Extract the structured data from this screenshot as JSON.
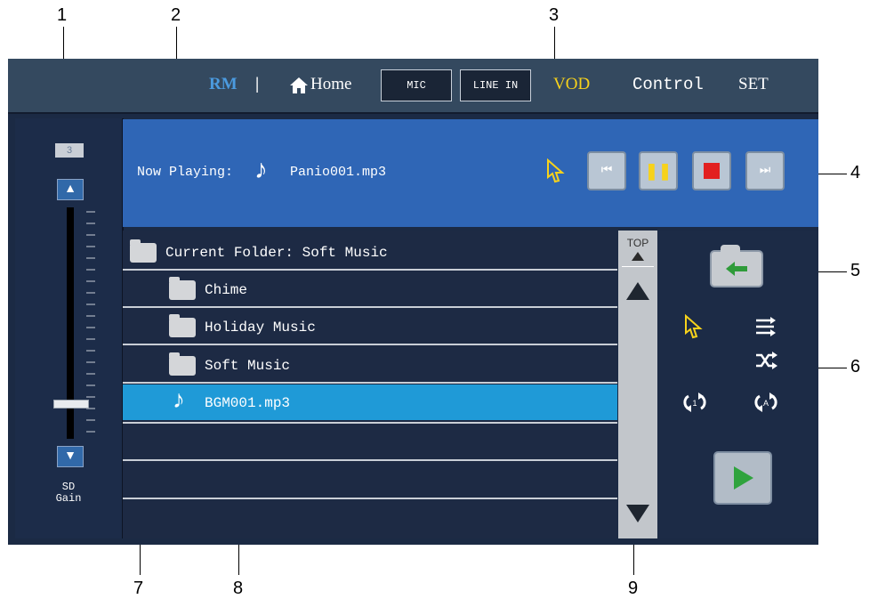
{
  "callouts": [
    "1",
    "2",
    "3",
    "4",
    "5",
    "6",
    "7",
    "8",
    "9"
  ],
  "topbar": {
    "rm": "RM",
    "sep": "|",
    "home_icon": "home-icon",
    "home": "Home",
    "mic": "MIC",
    "line_in": "LINE IN",
    "vod": "VOD",
    "control": "Control",
    "set": "SET"
  },
  "left_panel": {
    "value": "3",
    "label_line1": "SD",
    "label_line2": "Gain",
    "level_fraction": 0.17
  },
  "now_playing": {
    "label": "Now Playing:",
    "file": "Panio001.mp3",
    "note_icon": "music-note-icon",
    "controls": [
      "previous-icon",
      "pause-icon",
      "stop-icon",
      "next-icon"
    ]
  },
  "browser": {
    "header": "Current Folder: Soft Music",
    "rows": [
      {
        "type": "folder",
        "label": "Chime"
      },
      {
        "type": "folder",
        "label": "Holiday Music"
      },
      {
        "type": "folder",
        "label": "Soft Music"
      },
      {
        "type": "file",
        "label": "BGM001.mp3",
        "selected": true
      }
    ]
  },
  "scrollbar": {
    "top_label": "TOP"
  },
  "right_panel": {
    "back_icon": "back-arrow-icon",
    "play_mode_icons": [
      "single-play-icon",
      "sequential-play-icon",
      "shuffle-icon",
      "repeat-one-icon",
      "repeat-all-icon"
    ],
    "play_icon": "play-icon"
  },
  "colors": {
    "screen_bg": "#1b2a44",
    "now_playing_bg": "#2f66b6",
    "selected_row": "#1f9ad7",
    "rm": "#4b9be0",
    "vod": "#f7d21b"
  }
}
